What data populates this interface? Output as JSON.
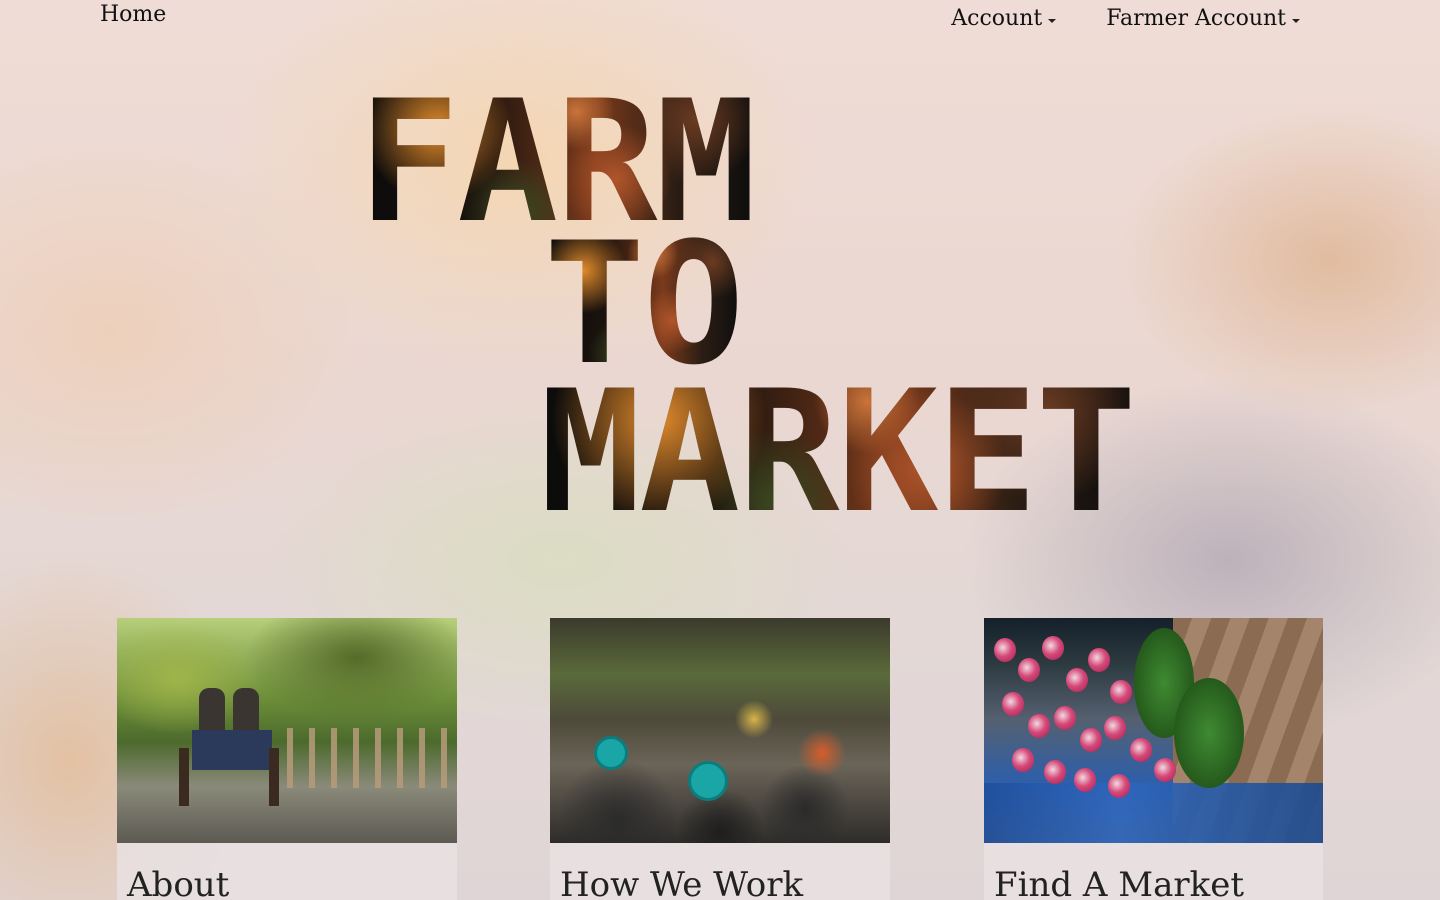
{
  "nav": {
    "home": "Home",
    "account": "Account",
    "farmer_account": "Farmer Account"
  },
  "hero": {
    "line1": "FARM",
    "line2": "TO",
    "line3": "MARKET"
  },
  "cards": [
    {
      "title": "About",
      "image": "farm-wagon-photo"
    },
    {
      "title": "How We Work",
      "image": "floating-market-photo"
    },
    {
      "title": "Find A Market",
      "image": "radishes-photo"
    }
  ]
}
